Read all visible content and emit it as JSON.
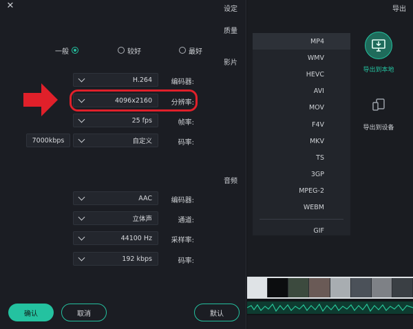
{
  "settings": {
    "title": "设定",
    "close_glyph": "✕",
    "quality": {
      "label": "质量",
      "options": [
        "最好",
        "较好",
        "一般"
      ],
      "selected": "一般"
    },
    "video": {
      "label": "影片",
      "fields": [
        {
          "label": "编码器:",
          "value": "H.264"
        },
        {
          "label": "分辨率:",
          "value": "4096x2160"
        },
        {
          "label": "帧率:",
          "value": "25 fps"
        },
        {
          "label": "码率:",
          "value": "自定义",
          "extra": "7000kbps"
        }
      ]
    },
    "audio": {
      "label": "音频",
      "fields": [
        {
          "label": "编码器:",
          "value": "AAC"
        },
        {
          "label": "通道:",
          "value": "立体声"
        },
        {
          "label": "采样率:",
          "value": "44100 Hz"
        },
        {
          "label": "码率:",
          "value": "192 kbps"
        }
      ]
    },
    "buttons": {
      "default": "默认",
      "cancel": "取消",
      "confirm": "确认"
    }
  },
  "export": {
    "title": "导出",
    "formats": [
      "MP4",
      "WMV",
      "HEVC",
      "AVI",
      "MOV",
      "F4V",
      "MKV",
      "TS",
      "3GP",
      "MPEG-2",
      "WEBM",
      "GIF"
    ],
    "selected_format": "MP4",
    "targets": [
      {
        "label": "导出到本地",
        "icon": "monitor-download-icon",
        "active": true
      },
      {
        "label": "导出到设备",
        "icon": "devices-icon",
        "active": false
      }
    ]
  },
  "colors": {
    "accent": "#24c2a0",
    "highlight": "#e0202a"
  }
}
